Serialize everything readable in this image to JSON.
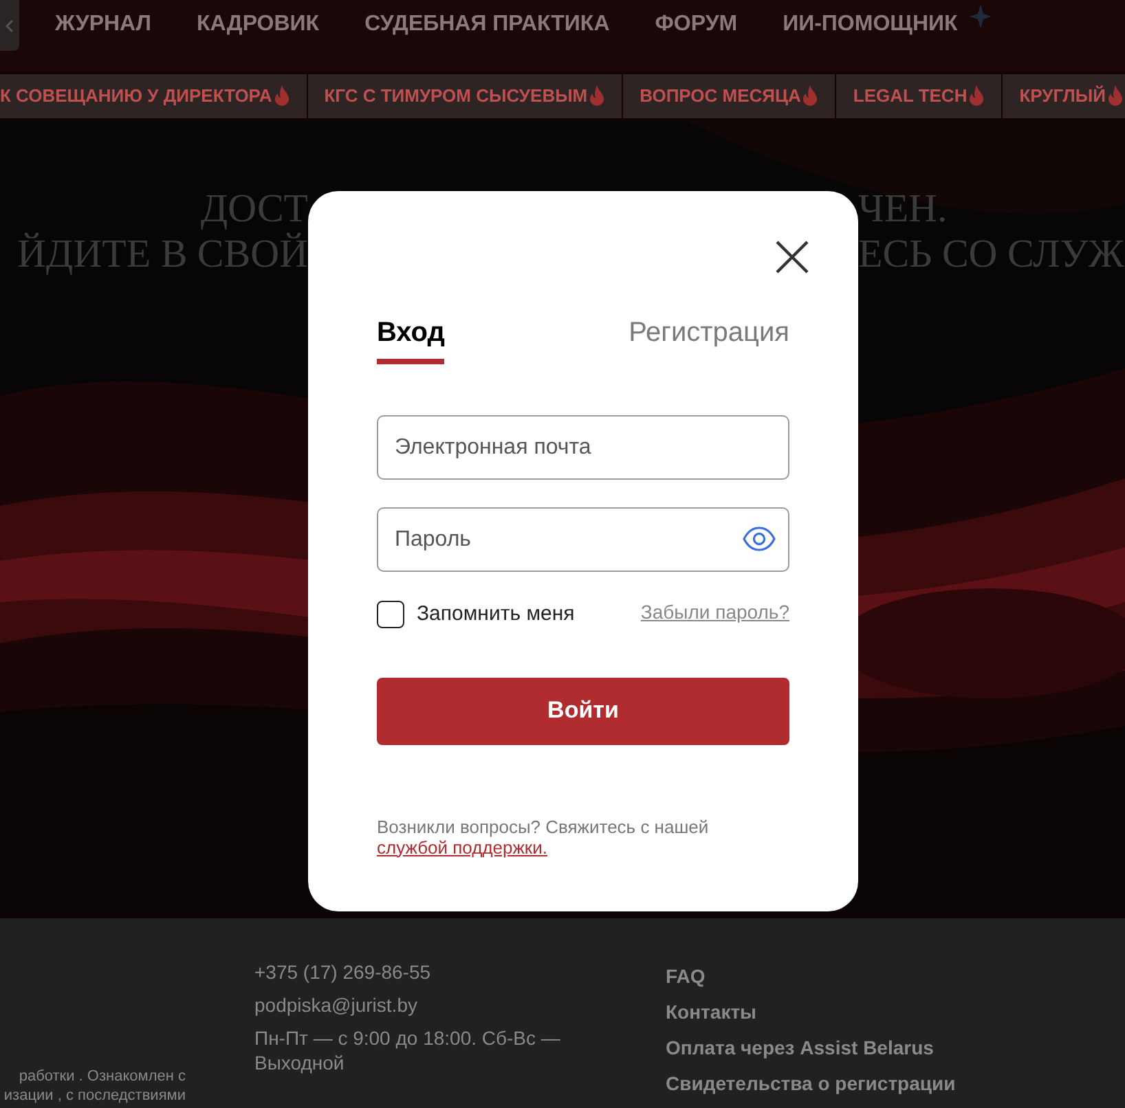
{
  "nav": {
    "items": [
      {
        "label": "ЖУРНАЛ"
      },
      {
        "label": "КАДРОВИК"
      },
      {
        "label": "СУДЕБНАЯ ПРАКТИКА"
      },
      {
        "label": "ФОРУМ"
      },
      {
        "label": "ИИ-ПОМОЩНИК"
      }
    ]
  },
  "strip": {
    "items": [
      {
        "label": "К СОВЕЩАНИЮ У ДИРЕКТОРА"
      },
      {
        "label": "КГС С ТИМУРОМ СЫСУЕВЫМ"
      },
      {
        "label": "ВОПРОС МЕСЯЦА"
      },
      {
        "label": "LEGAL TECH"
      },
      {
        "label": "КРУГЛЫЙ"
      }
    ]
  },
  "hero": {
    "lines": [
      {
        "left": "ДОСТ",
        "right": "ЧЕН."
      },
      {
        "left": "ЙДИТЕ В СВОЙ",
        "right": "ЕСЬ СО СЛУЖ"
      }
    ]
  },
  "modal": {
    "tabs": [
      {
        "label": "Вход",
        "selected": true
      },
      {
        "label": "Регистрация",
        "selected": false
      }
    ],
    "email": {
      "placeholder": "Электронная почта"
    },
    "password": {
      "placeholder": "Пароль"
    },
    "remember": {
      "label": "Запомнить меня",
      "checked": false
    },
    "forgot": "Забыли пароль?",
    "submit": "Войти",
    "help": "Возникли вопросы? Свяжитесь с нашей",
    "help_link": "службой поддержки."
  },
  "footer": {
    "legal": [
      "работки . Ознакомлен с",
      "изации , с последствиями"
    ],
    "contacts": [
      "+375 (17) 269-86-55",
      "podpiska@jurist.by",
      "Пн-Пт — с 9:00 до 18:00. Сб-Вс — Выходной"
    ],
    "links": [
      "FAQ",
      "Контакты",
      "Оплата через Assist Belarus",
      "Свидетельства о регистрации"
    ]
  }
}
